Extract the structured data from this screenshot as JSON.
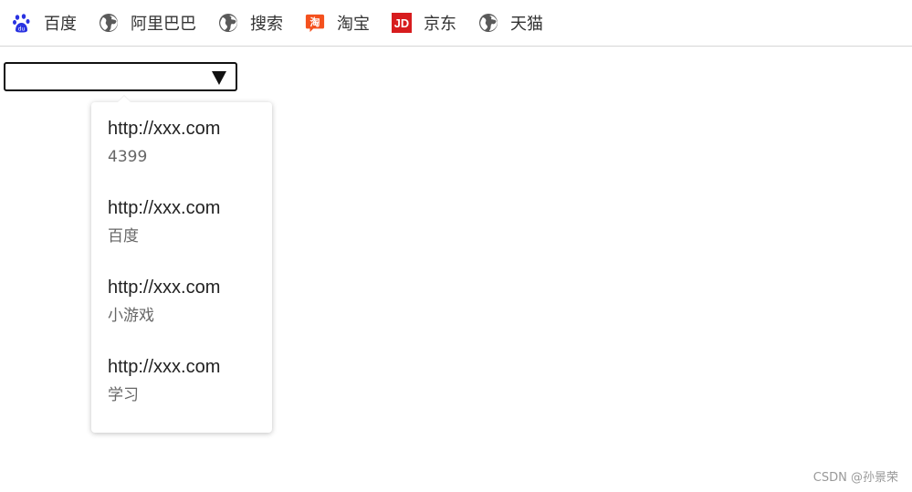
{
  "bookmarks": [
    {
      "label": "百度",
      "icon": "baidu-paw-icon"
    },
    {
      "label": "阿里巴巴",
      "icon": "globe-icon"
    },
    {
      "label": "搜索",
      "icon": "globe-icon"
    },
    {
      "label": "淘宝",
      "icon": "taobao-icon"
    },
    {
      "label": "京东",
      "icon": "jd-icon"
    },
    {
      "label": "天猫",
      "icon": "globe-icon"
    }
  ],
  "select": {
    "value": ""
  },
  "options": [
    {
      "url": "http://xxx.com",
      "desc": "4399"
    },
    {
      "url": "http://xxx.com",
      "desc": "百度"
    },
    {
      "url": "http://xxx.com",
      "desc": "小游戏"
    },
    {
      "url": "http://xxx.com",
      "desc": "学习"
    }
  ],
  "watermark": "CSDN @孙景荣",
  "colors": {
    "baidu_blue": "#2932e1",
    "globe_gray": "#5a5a5a",
    "taobao_orange": "#f4511e",
    "jd_red": "#d71c1e",
    "border": "#d6d6d6"
  }
}
